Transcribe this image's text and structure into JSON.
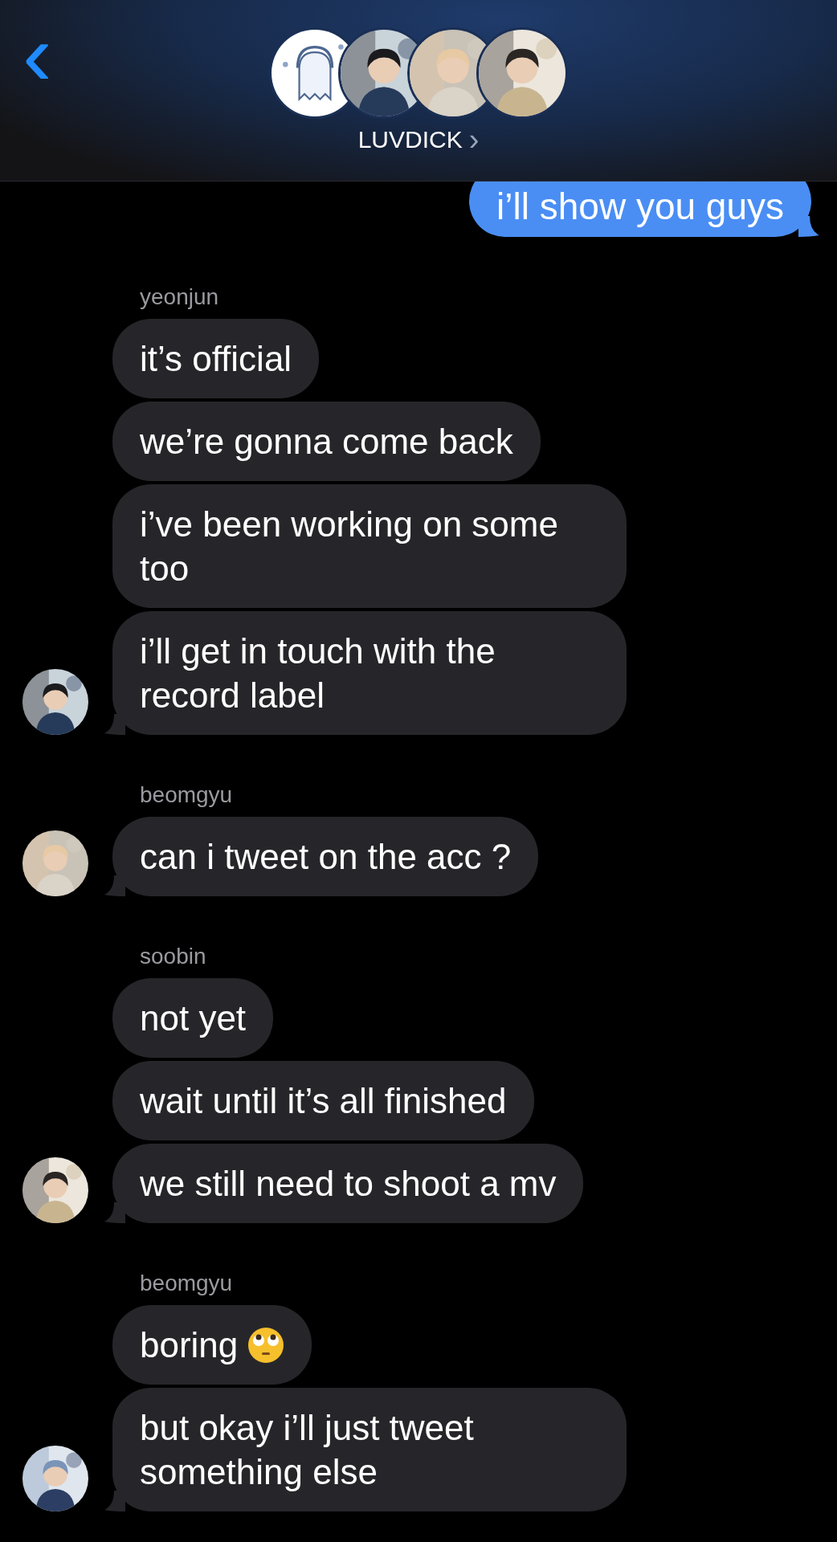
{
  "header": {
    "back": "‹",
    "title": "LUVDICK",
    "title_chevron": "›",
    "avatars": [
      {
        "kind": "drawing"
      },
      {
        "kind": "picture"
      },
      {
        "kind": "picture"
      },
      {
        "kind": "picture"
      }
    ]
  },
  "sent": [
    {
      "text": "i’ll show you guys"
    }
  ],
  "groups": [
    {
      "sender": "yeonjun",
      "avatar": {
        "kind": "picture"
      },
      "messages": [
        {
          "text": "it’s official"
        },
        {
          "text": "we’re gonna come back"
        },
        {
          "text": "i’ve been working on some too"
        },
        {
          "text": "i’ll get in touch with the record label"
        }
      ]
    },
    {
      "sender": "beomgyu",
      "avatar": {
        "kind": "picture"
      },
      "messages": [
        {
          "text": "can i tweet on the acc ?"
        }
      ]
    },
    {
      "sender": "soobin",
      "avatar": {
        "kind": "picture"
      },
      "messages": [
        {
          "text": "not yet"
        },
        {
          "text": "wait until it’s all finished"
        },
        {
          "text": "we still need to shoot a mv"
        }
      ]
    },
    {
      "sender": "beomgyu",
      "avatar": {
        "kind": "picture"
      },
      "messages": [
        {
          "text": "boring",
          "emoji": true
        },
        {
          "text": "but okay i’ll just tweet something else"
        }
      ]
    }
  ]
}
